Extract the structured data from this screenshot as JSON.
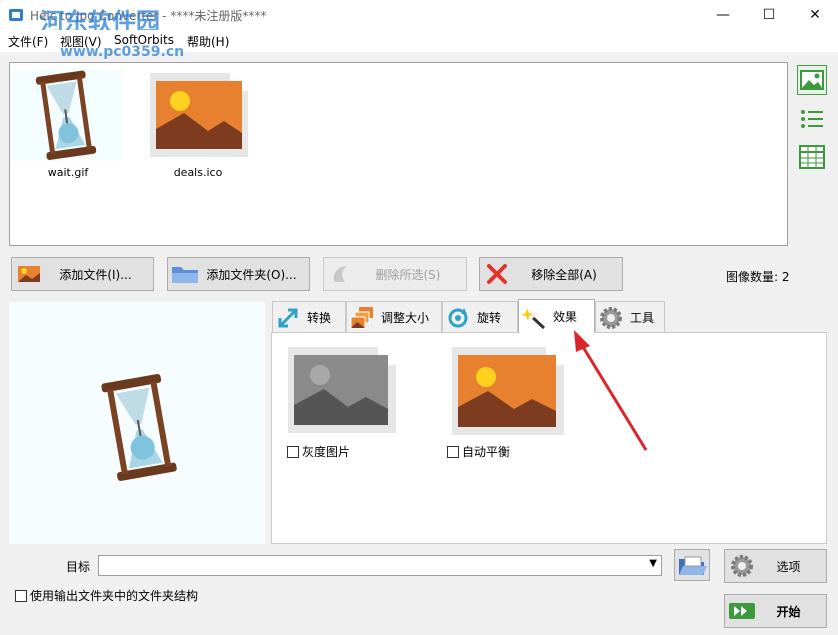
{
  "window": {
    "title": "Heic to Jpg Converter - ****未注册版****",
    "watermark": "河东软件园",
    "watermark_url": "www.pc0359.cn",
    "minimize": "—",
    "maximize": "☐",
    "close": "✕"
  },
  "menu": {
    "file": "文件(F)",
    "view": "视图(V)",
    "softorbits": "SoftOrbits",
    "help": "帮助(H)"
  },
  "files": [
    {
      "name": "wait.gif"
    },
    {
      "name": "deals.ico"
    }
  ],
  "buttons": {
    "add_file": "添加文件(I)...",
    "add_folder": "添加文件夹(O)...",
    "remove_selected": "删除所选(S)",
    "remove_all": "移除全部(A)"
  },
  "image_count": "图像数量: 2",
  "tabs": [
    {
      "label": "转换"
    },
    {
      "label": "调整大小"
    },
    {
      "label": "旋转"
    },
    {
      "label": "效果"
    },
    {
      "label": "工具"
    }
  ],
  "effects": {
    "grayscale": "灰度图片",
    "auto_balance": "自动平衡"
  },
  "bottom": {
    "target_label": "目标",
    "target_value": "",
    "use_structure": "使用输出文件夹中的文件夹结构",
    "options": "选项",
    "start": "开始"
  },
  "colors": {
    "accent_green": "#3c9a3c",
    "arrow_red": "#d9262a",
    "image_orange": "#e8812f"
  }
}
